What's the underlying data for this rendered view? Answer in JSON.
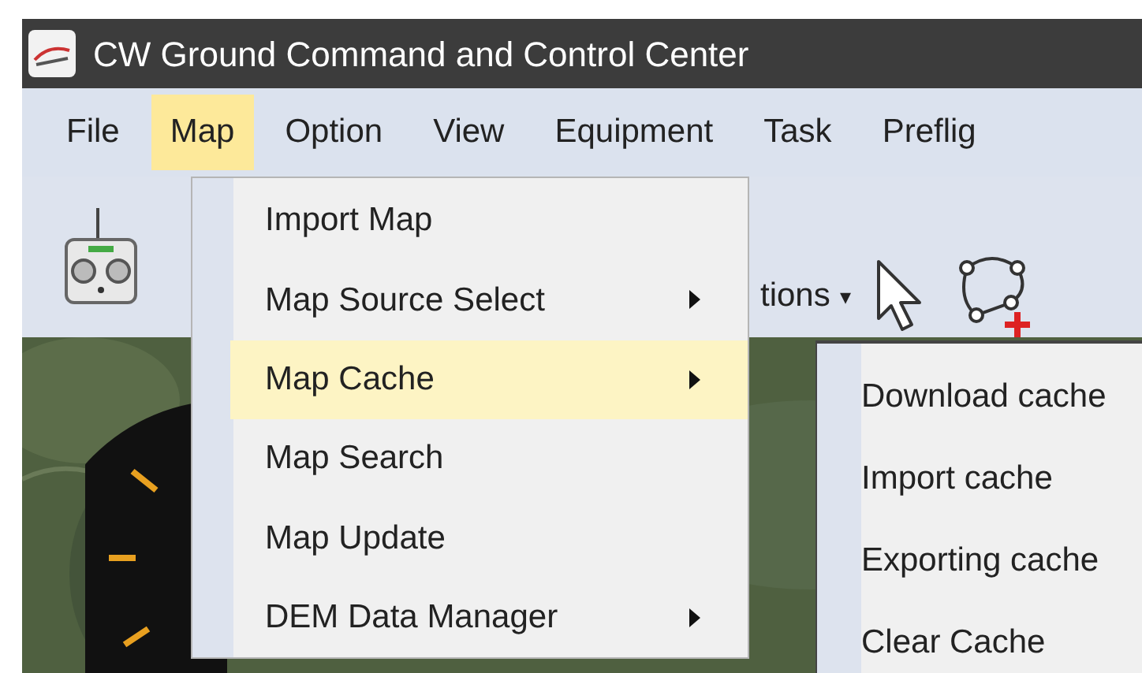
{
  "window": {
    "title": "CW Ground Command and Control Center"
  },
  "menu_bar": [
    {
      "label": "File",
      "selected": false
    },
    {
      "label": "Map",
      "selected": true
    },
    {
      "label": "Option",
      "selected": false
    },
    {
      "label": "View",
      "selected": false
    },
    {
      "label": "Equipment",
      "selected": false
    },
    {
      "label": "Task",
      "selected": false
    },
    {
      "label": "Preflig",
      "selected": false
    }
  ],
  "toolbar": {
    "dropdown_label": "tions",
    "dropdown_caret": "▾"
  },
  "map_menu": [
    {
      "label": "Import Map",
      "submenu": false,
      "selected": false
    },
    {
      "label": "Map Source Select",
      "submenu": true,
      "selected": false
    },
    {
      "label": "Map Cache",
      "submenu": true,
      "selected": true
    },
    {
      "label": "Map Search",
      "submenu": false,
      "selected": false
    },
    {
      "label": "Map Update",
      "submenu": false,
      "selected": false
    },
    {
      "label": "DEM Data Manager",
      "submenu": true,
      "selected": false
    }
  ],
  "cache_submenu": [
    {
      "label": "Download cache"
    },
    {
      "label": "Import cache"
    },
    {
      "label": "Exporting cache"
    },
    {
      "label": "Clear Cache"
    }
  ]
}
